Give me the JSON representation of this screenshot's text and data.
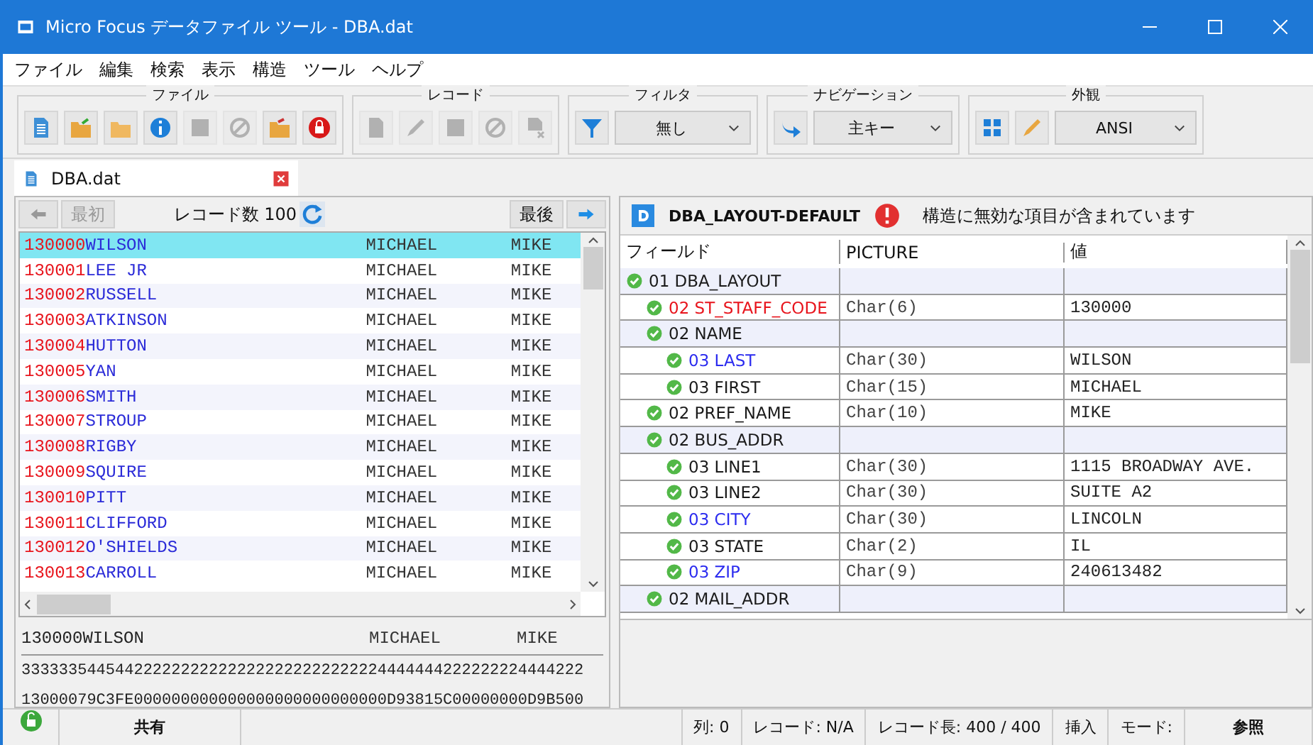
{
  "window": {
    "title": "Micro Focus データファイル ツール - DBA.dat"
  },
  "menu": [
    "ファイル",
    "編集",
    "検索",
    "表示",
    "構造",
    "ツール",
    "ヘルプ"
  ],
  "toolbar": [
    {
      "title": "ファイル",
      "buttons": [
        {
          "disabled": false
        },
        {
          "disabled": false
        },
        {
          "disabled": false
        },
        {
          "disabled": false
        },
        {
          "disabled": true
        },
        {
          "disabled": true
        },
        {
          "disabled": false
        },
        {
          "disabled": false
        }
      ]
    },
    {
      "title": "レコード",
      "buttons": [
        {
          "disabled": true
        },
        {
          "disabled": true
        },
        {
          "disabled": true
        },
        {
          "disabled": true
        },
        {
          "disabled": true
        }
      ]
    },
    {
      "title": "フィルタ",
      "buttons": [
        {
          "disabled": false
        }
      ],
      "dropdown": "無し"
    },
    {
      "title": "ナビゲーション",
      "buttons": [
        {
          "disabled": false
        }
      ],
      "dropdown": "主キー"
    },
    {
      "title": "外観",
      "buttons": [
        {
          "disabled": false
        },
        {
          "disabled": false
        }
      ],
      "dropdown": "ANSI"
    }
  ],
  "tabs": [
    {
      "label": "DBA.dat",
      "selected": true
    }
  ],
  "record_nav": {
    "first": "最初",
    "first_disabled": true,
    "count": "レコード数 100",
    "last": "最後"
  },
  "records": [
    {
      "id": "130000",
      "name": "WILSON",
      "first": "MICHAEL",
      "pref": "MIKE",
      "selected": true
    },
    {
      "id": "130001",
      "name": "LEE JR",
      "first": "MICHAEL",
      "pref": "MIKE",
      "selected": false
    },
    {
      "id": "130002",
      "name": "RUSSELL",
      "first": "MICHAEL",
      "pref": "MIKE",
      "selected": false
    },
    {
      "id": "130003",
      "name": "ATKINSON",
      "first": "MICHAEL",
      "pref": "MIKE",
      "selected": false
    },
    {
      "id": "130004",
      "name": "HUTTON",
      "first": "MICHAEL",
      "pref": "MIKE",
      "selected": false
    },
    {
      "id": "130005",
      "name": "YAN",
      "first": "MICHAEL",
      "pref": "MIKE",
      "selected": false
    },
    {
      "id": "130006",
      "name": "SMITH",
      "first": "MICHAEL",
      "pref": "MIKE",
      "selected": false
    },
    {
      "id": "130007",
      "name": "STROUP",
      "first": "MICHAEL",
      "pref": "MIKE",
      "selected": false
    },
    {
      "id": "130008",
      "name": "RIGBY",
      "first": "MICHAEL",
      "pref": "MIKE",
      "selected": false
    },
    {
      "id": "130009",
      "name": "SQUIRE",
      "first": "MICHAEL",
      "pref": "MIKE",
      "selected": false
    },
    {
      "id": "130010",
      "name": "PITT",
      "first": "MICHAEL",
      "pref": "MIKE",
      "selected": false
    },
    {
      "id": "130011",
      "name": "CLIFFORD",
      "first": "MICHAEL",
      "pref": "MIKE",
      "selected": false
    },
    {
      "id": "130012",
      "name": "O'SHIELDS",
      "first": "MICHAEL",
      "pref": "MIKE",
      "selected": false
    },
    {
      "id": "130013",
      "name": "CARROLL",
      "first": "MICHAEL",
      "pref": "MIKE",
      "selected": false
    }
  ],
  "preview": {
    "text": [
      "130000WILSON",
      "MICHAEL",
      "MIKE"
    ],
    "hex_high": "333333544544222222222222222222222222224444444222222224444222",
    "hex_low": "13000079C3FE000000000000000000000000000D93815C00000000D9B500"
  },
  "layout": {
    "name": "DBA_LAYOUT-DEFAULT",
    "message": "構造に無効な項目が含まれています",
    "columns": [
      "フィールド",
      "PICTURE",
      "値"
    ],
    "fields": [
      {
        "label": "01 DBA_LAYOUT",
        "color": "#1a1a1a",
        "children": [
          {
            "label": "02 ST_STAFF_CODE",
            "color": "#e8141c",
            "picture": "Char(6)",
            "value": "130000"
          },
          {
            "label": "02 NAME",
            "color": "#1a1a1a",
            "children": [
              {
                "label": "03 LAST",
                "color": "#2b2bef",
                "picture": "Char(30)",
                "value": "WILSON"
              },
              {
                "label": "03 FIRST",
                "color": "#1a1a1a",
                "picture": "Char(15)",
                "value": "MICHAEL"
              }
            ]
          },
          {
            "label": "02 PREF_NAME",
            "color": "#1a1a1a",
            "picture": "Char(10)",
            "value": "MIKE"
          },
          {
            "label": "02 BUS_ADDR",
            "color": "#1a1a1a",
            "children": [
              {
                "label": "03 LINE1",
                "color": "#1a1a1a",
                "picture": "Char(30)",
                "value": "1115 BROADWAY AVE."
              },
              {
                "label": "03 LINE2",
                "color": "#1a1a1a",
                "picture": "Char(30)",
                "value": "SUITE A2"
              },
              {
                "label": "03 CITY",
                "color": "#2b2bef",
                "picture": "Char(30)",
                "value": "LINCOLN"
              },
              {
                "label": "03 STATE",
                "color": "#1a1a1a",
                "picture": "Char(2)",
                "value": "IL"
              },
              {
                "label": "03 ZIP",
                "color": "#2b2bef",
                "picture": "Char(9)",
                "value": "240613482"
              }
            ]
          },
          {
            "label": "02 MAIL_ADDR",
            "color": "#1a1a1a"
          }
        ]
      }
    ]
  },
  "status": {
    "share": "共有",
    "column": "列: 0",
    "record": "レコード: N/A",
    "length": "レコード長: 400 / 400",
    "insert": "挿入",
    "mode_label": "モード:",
    "mode": "参照"
  }
}
